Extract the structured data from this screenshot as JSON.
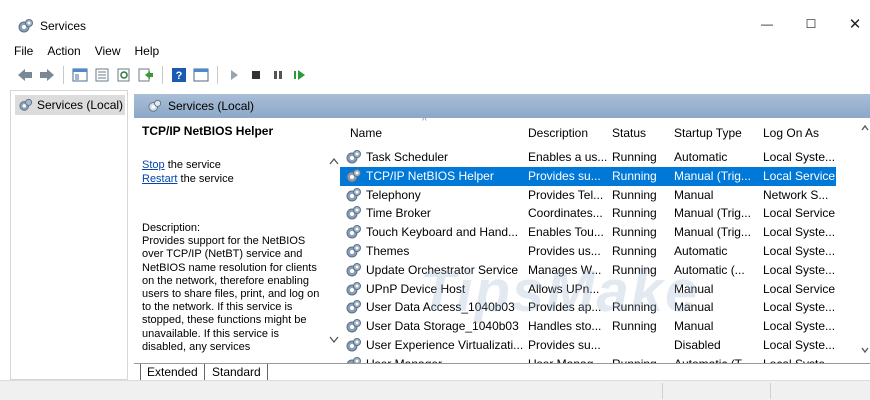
{
  "window": {
    "title": "Services",
    "minimize_glyph": "—",
    "maximize_glyph": "☐",
    "close_glyph": "✕"
  },
  "menu": [
    "File",
    "Action",
    "View",
    "Help"
  ],
  "toolbar_icons": [
    "back-icon",
    "forward-icon",
    "console-tree-icon",
    "properties-icon",
    "refresh-icon",
    "export-icon",
    "help-icon",
    "view-icon",
    "start-icon",
    "stop-icon",
    "pause-icon",
    "restart-icon"
  ],
  "tree": {
    "item": "Services (Local)"
  },
  "panel": {
    "header": "Services (Local)"
  },
  "detail": {
    "title": "TCP/IP NetBIOS Helper",
    "stop_link": "Stop",
    "stop_suffix": " the service",
    "restart_link": "Restart",
    "restart_suffix": " the service",
    "description_label": "Description:",
    "description": "Provides support for the NetBIOS over TCP/IP (NetBT) service and NetBIOS name resolution for clients on the network, therefore enabling users to share files, print, and log on to the network. If this service is stopped, these functions might be unavailable. If this service is disabled, any services"
  },
  "columns": [
    "Name",
    "Description",
    "Status",
    "Startup Type",
    "Log On As"
  ],
  "rows": [
    {
      "name": "Task Scheduler",
      "desc": "Enables a us...",
      "status": "Running",
      "startup": "Automatic",
      "logon": "Local Syste..."
    },
    {
      "name": "TCP/IP NetBIOS Helper",
      "desc": "Provides su...",
      "status": "Running",
      "startup": "Manual (Trig...",
      "logon": "Local Service"
    },
    {
      "name": "Telephony",
      "desc": "Provides Tel...",
      "status": "Running",
      "startup": "Manual",
      "logon": "Network S..."
    },
    {
      "name": "Time Broker",
      "desc": "Coordinates...",
      "status": "Running",
      "startup": "Manual (Trig...",
      "logon": "Local Service"
    },
    {
      "name": "Touch Keyboard and Hand...",
      "desc": "Enables Tou...",
      "status": "Running",
      "startup": "Manual (Trig...",
      "logon": "Local Syste..."
    },
    {
      "name": "Themes",
      "desc": "Provides us...",
      "status": "Running",
      "startup": "Automatic",
      "logon": "Local Syste..."
    },
    {
      "name": "Update Orchestrator Service",
      "desc": "Manages W...",
      "status": "Running",
      "startup": "Automatic (...",
      "logon": "Local Syste..."
    },
    {
      "name": "UPnP Device Host",
      "desc": "Allows UPn...",
      "status": "",
      "startup": "Manual",
      "logon": "Local Service"
    },
    {
      "name": "User Data Access_1040b03",
      "desc": "Provides ap...",
      "status": "Running",
      "startup": "Manual",
      "logon": "Local Syste..."
    },
    {
      "name": "User Data Storage_1040b03",
      "desc": "Handles sto...",
      "status": "Running",
      "startup": "Manual",
      "logon": "Local Syste..."
    },
    {
      "name": "User Experience Virtualizati...",
      "desc": "Provides su...",
      "status": "",
      "startup": "Disabled",
      "logon": "Local Syste..."
    },
    {
      "name": "User Manager",
      "desc": "User Manag...",
      "status": "Running",
      "startup": "Automatic (T...",
      "logon": "Local Syste..."
    }
  ],
  "selected_row": 1,
  "tabs": [
    "Extended",
    "Standard"
  ],
  "watermark": "TipsMake",
  "colors": {
    "selection": "#0078d7",
    "header": "#9fb6d2",
    "link": "#0645ad"
  }
}
